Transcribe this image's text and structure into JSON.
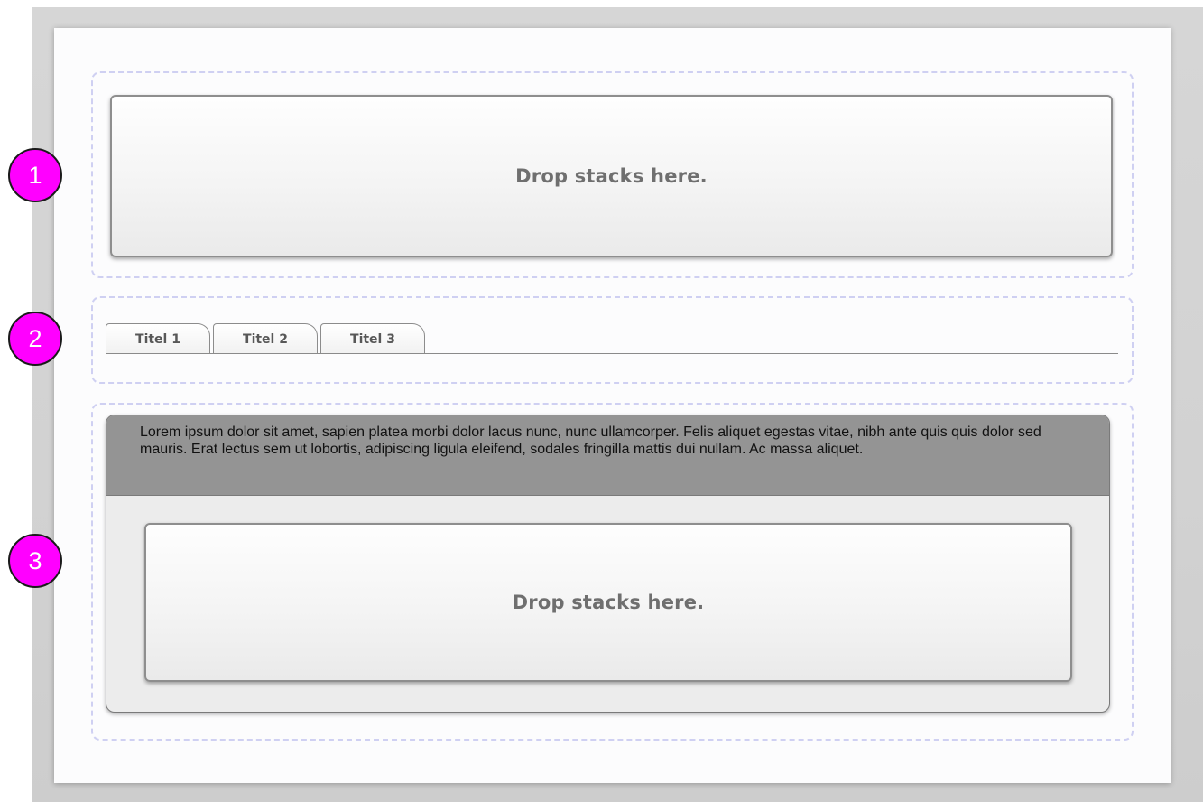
{
  "badges": {
    "one": "1",
    "two": "2",
    "three": "3"
  },
  "header_region": {
    "drop_label": "Drop stacks here."
  },
  "tabs": [
    {
      "label": "Titel 1"
    },
    {
      "label": "Titel 2"
    },
    {
      "label": "Titel 3"
    }
  ],
  "content_region": {
    "text": "Lorem ipsum dolor sit amet, sapien platea morbi dolor lacus nunc, nunc ullamcorper. Felis aliquet egestas vitae, nibh ante quis quis dolor sed mauris. Erat lectus sem ut lobortis, adipiscing ligula eleifend, sodales fringilla mattis dui nullam. Ac massa aliquet.",
    "drop_label": "Drop stacks here."
  },
  "colors": {
    "badge_fill": "#ff00ff",
    "dashed_outline": "#cfd0f2",
    "content_header_bg": "#949494",
    "content_panel_bg": "#ececec"
  }
}
